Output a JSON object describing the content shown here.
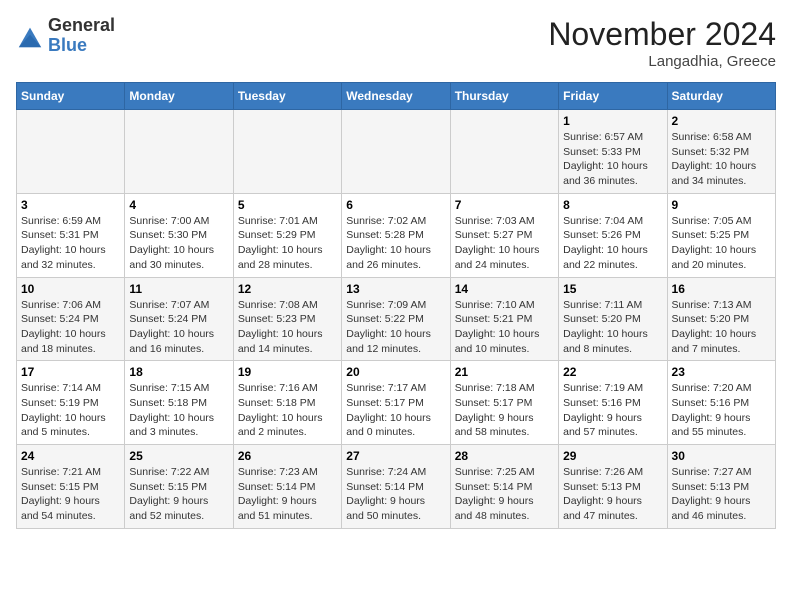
{
  "header": {
    "logo": {
      "text_general": "General",
      "text_blue": "Blue"
    },
    "title": "November 2024",
    "subtitle": "Langadhia, Greece"
  },
  "calendar": {
    "days_of_week": [
      "Sunday",
      "Monday",
      "Tuesday",
      "Wednesday",
      "Thursday",
      "Friday",
      "Saturday"
    ],
    "weeks": [
      [
        {
          "day": "",
          "info": ""
        },
        {
          "day": "",
          "info": ""
        },
        {
          "day": "",
          "info": ""
        },
        {
          "day": "",
          "info": ""
        },
        {
          "day": "",
          "info": ""
        },
        {
          "day": "1",
          "info": "Sunrise: 6:57 AM\nSunset: 5:33 PM\nDaylight: 10 hours and 36 minutes."
        },
        {
          "day": "2",
          "info": "Sunrise: 6:58 AM\nSunset: 5:32 PM\nDaylight: 10 hours and 34 minutes."
        }
      ],
      [
        {
          "day": "3",
          "info": "Sunrise: 6:59 AM\nSunset: 5:31 PM\nDaylight: 10 hours and 32 minutes."
        },
        {
          "day": "4",
          "info": "Sunrise: 7:00 AM\nSunset: 5:30 PM\nDaylight: 10 hours and 30 minutes."
        },
        {
          "day": "5",
          "info": "Sunrise: 7:01 AM\nSunset: 5:29 PM\nDaylight: 10 hours and 28 minutes."
        },
        {
          "day": "6",
          "info": "Sunrise: 7:02 AM\nSunset: 5:28 PM\nDaylight: 10 hours and 26 minutes."
        },
        {
          "day": "7",
          "info": "Sunrise: 7:03 AM\nSunset: 5:27 PM\nDaylight: 10 hours and 24 minutes."
        },
        {
          "day": "8",
          "info": "Sunrise: 7:04 AM\nSunset: 5:26 PM\nDaylight: 10 hours and 22 minutes."
        },
        {
          "day": "9",
          "info": "Sunrise: 7:05 AM\nSunset: 5:25 PM\nDaylight: 10 hours and 20 minutes."
        }
      ],
      [
        {
          "day": "10",
          "info": "Sunrise: 7:06 AM\nSunset: 5:24 PM\nDaylight: 10 hours and 18 minutes."
        },
        {
          "day": "11",
          "info": "Sunrise: 7:07 AM\nSunset: 5:24 PM\nDaylight: 10 hours and 16 minutes."
        },
        {
          "day": "12",
          "info": "Sunrise: 7:08 AM\nSunset: 5:23 PM\nDaylight: 10 hours and 14 minutes."
        },
        {
          "day": "13",
          "info": "Sunrise: 7:09 AM\nSunset: 5:22 PM\nDaylight: 10 hours and 12 minutes."
        },
        {
          "day": "14",
          "info": "Sunrise: 7:10 AM\nSunset: 5:21 PM\nDaylight: 10 hours and 10 minutes."
        },
        {
          "day": "15",
          "info": "Sunrise: 7:11 AM\nSunset: 5:20 PM\nDaylight: 10 hours and 8 minutes."
        },
        {
          "day": "16",
          "info": "Sunrise: 7:13 AM\nSunset: 5:20 PM\nDaylight: 10 hours and 7 minutes."
        }
      ],
      [
        {
          "day": "17",
          "info": "Sunrise: 7:14 AM\nSunset: 5:19 PM\nDaylight: 10 hours and 5 minutes."
        },
        {
          "day": "18",
          "info": "Sunrise: 7:15 AM\nSunset: 5:18 PM\nDaylight: 10 hours and 3 minutes."
        },
        {
          "day": "19",
          "info": "Sunrise: 7:16 AM\nSunset: 5:18 PM\nDaylight: 10 hours and 2 minutes."
        },
        {
          "day": "20",
          "info": "Sunrise: 7:17 AM\nSunset: 5:17 PM\nDaylight: 10 hours and 0 minutes."
        },
        {
          "day": "21",
          "info": "Sunrise: 7:18 AM\nSunset: 5:17 PM\nDaylight: 9 hours and 58 minutes."
        },
        {
          "day": "22",
          "info": "Sunrise: 7:19 AM\nSunset: 5:16 PM\nDaylight: 9 hours and 57 minutes."
        },
        {
          "day": "23",
          "info": "Sunrise: 7:20 AM\nSunset: 5:16 PM\nDaylight: 9 hours and 55 minutes."
        }
      ],
      [
        {
          "day": "24",
          "info": "Sunrise: 7:21 AM\nSunset: 5:15 PM\nDaylight: 9 hours and 54 minutes."
        },
        {
          "day": "25",
          "info": "Sunrise: 7:22 AM\nSunset: 5:15 PM\nDaylight: 9 hours and 52 minutes."
        },
        {
          "day": "26",
          "info": "Sunrise: 7:23 AM\nSunset: 5:14 PM\nDaylight: 9 hours and 51 minutes."
        },
        {
          "day": "27",
          "info": "Sunrise: 7:24 AM\nSunset: 5:14 PM\nDaylight: 9 hours and 50 minutes."
        },
        {
          "day": "28",
          "info": "Sunrise: 7:25 AM\nSunset: 5:14 PM\nDaylight: 9 hours and 48 minutes."
        },
        {
          "day": "29",
          "info": "Sunrise: 7:26 AM\nSunset: 5:13 PM\nDaylight: 9 hours and 47 minutes."
        },
        {
          "day": "30",
          "info": "Sunrise: 7:27 AM\nSunset: 5:13 PM\nDaylight: 9 hours and 46 minutes."
        }
      ]
    ]
  }
}
